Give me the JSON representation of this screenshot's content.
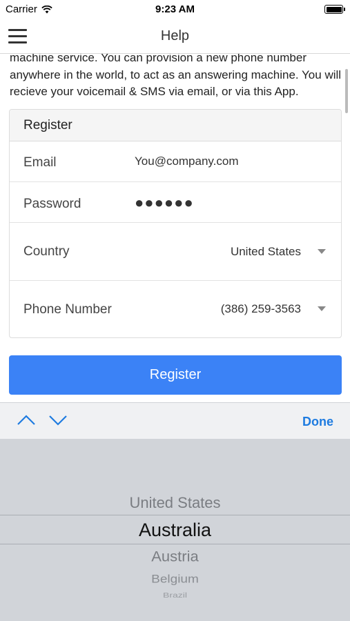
{
  "status_bar": {
    "carrier": "Carrier",
    "time": "9:23 AM"
  },
  "nav": {
    "title": "Help"
  },
  "intro_text": "machine service. You can provision a new phone number anywhere in the world, to act as an answering machine. You will recieve your voicemail & SMS via email, or via this App.",
  "form": {
    "header": "Register",
    "email": {
      "label": "Email",
      "value": "You@company.com"
    },
    "password": {
      "label": "Password",
      "value": "●●●●●●"
    },
    "country": {
      "label": "Country",
      "value": "United States"
    },
    "phone": {
      "label": "Phone Number",
      "value": "(386) 259-3563"
    }
  },
  "register_button": "Register",
  "accessory": {
    "done": "Done"
  },
  "picker": {
    "options": [
      "United States",
      "Australia",
      "Austria",
      "Belgium",
      "Brazil",
      ""
    ],
    "selected": "Australia"
  },
  "colors": {
    "accent": "#3b82f6",
    "done": "#1e7be0",
    "picker_bg": "#d1d4d9"
  }
}
